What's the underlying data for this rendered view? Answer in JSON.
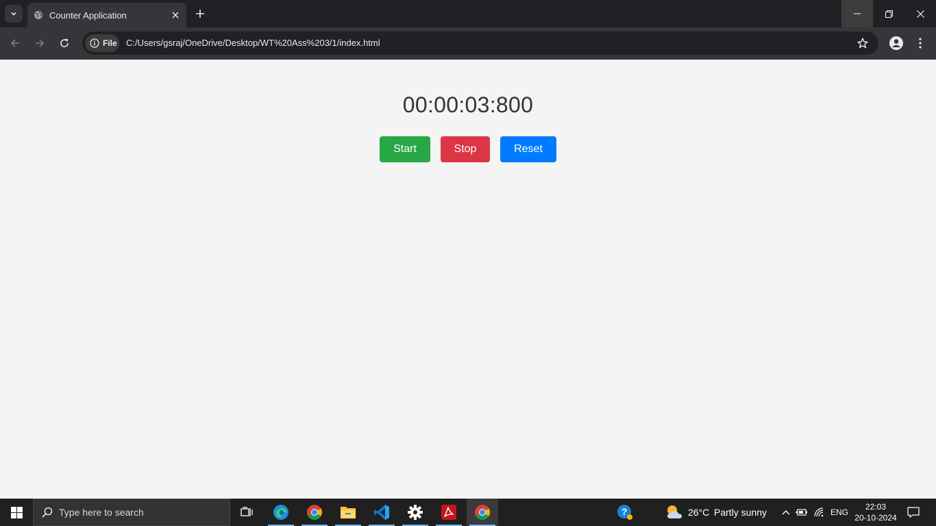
{
  "browser": {
    "tab_title": "Counter Application",
    "site_chip_label": "File",
    "url": "C:/Users/gsraj/OneDrive/Desktop/WT%20Ass%203/1/index.html"
  },
  "page": {
    "timer": "00:00:03:800",
    "start_label": "Start",
    "stop_label": "Stop",
    "reset_label": "Reset",
    "colors": {
      "start": "#28a745",
      "stop": "#dc3545",
      "reset": "#007bff",
      "background": "#f4f4f4"
    }
  },
  "taskbar": {
    "search_placeholder": "Type here to search",
    "apps": [
      "task-view",
      "edge",
      "chrome",
      "file-explorer",
      "vscode",
      "settings",
      "acrobat",
      "chrome-active"
    ],
    "weather_temp": "26°C",
    "weather_desc": "Partly sunny",
    "language": "ENG",
    "time": "22:03",
    "date": "20-10-2024"
  }
}
